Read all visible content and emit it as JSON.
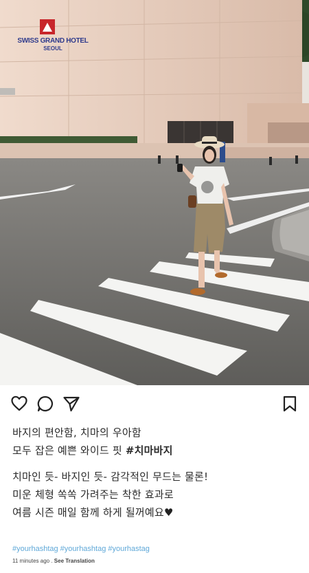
{
  "photo": {
    "hotel_sign_line1": "SWISS GRAND HOTEL",
    "hotel_sign_line2": "SEOUL"
  },
  "actions": {
    "like_icon": "heart-outline-icon",
    "comment_icon": "comment-bubble-icon",
    "share_icon": "paper-plane-icon",
    "save_icon": "bookmark-outline-icon"
  },
  "caption": {
    "line1": "바지의 편안함, 치마의 우아함",
    "line2_text": "모두 잡은 예쁜 와이드 핏 ",
    "line2_hashtag": "#치마바지",
    "line3": "치마인 듯- 바지인 듯- 감각적인 무드는 물론!",
    "line4": "미운 체형 쏙쏙 가려주는 착한 효과로",
    "line5_text": "여름 시즌 매일 함께 하게 될꺼예요",
    "line5_heart": "♥"
  },
  "tags": [
    "#yourhashtag",
    "#yourhashtag",
    "#yourhastag"
  ],
  "meta": {
    "time": "11 minutes ago",
    "separator": " . ",
    "translate": "See Translation"
  }
}
